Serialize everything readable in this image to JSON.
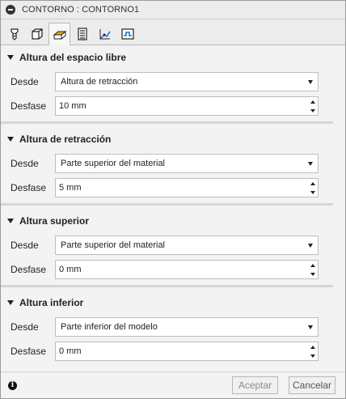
{
  "window": {
    "title": "CONTORNO : CONTORNO1"
  },
  "tabs": [
    {
      "icon": "tool-icon"
    },
    {
      "icon": "geometry-icon"
    },
    {
      "icon": "heights-icon",
      "active": true
    },
    {
      "icon": "passes-icon"
    },
    {
      "icon": "linking-icon"
    },
    {
      "icon": "post-process-icon"
    }
  ],
  "sections": [
    {
      "title": "Altura del espacio libre",
      "from_label": "Desde",
      "from_value": "Altura de retracción",
      "offset_label": "Desfase",
      "offset_value": "10 mm"
    },
    {
      "title": "Altura de retracción",
      "from_label": "Desde",
      "from_value": "Parte superior del material",
      "offset_label": "Desfase",
      "offset_value": "5 mm"
    },
    {
      "title": "Altura superior",
      "from_label": "Desde",
      "from_value": "Parte superior del material",
      "offset_label": "Desfase",
      "offset_value": "0 mm"
    },
    {
      "title": "Altura inferior",
      "from_label": "Desde",
      "from_value": "Parte inferior del modelo",
      "offset_label": "Desfase",
      "offset_value": "0 mm"
    }
  ],
  "footer": {
    "info_icon": "i",
    "ok_label": "Aceptar",
    "cancel_label": "Cancelar"
  }
}
